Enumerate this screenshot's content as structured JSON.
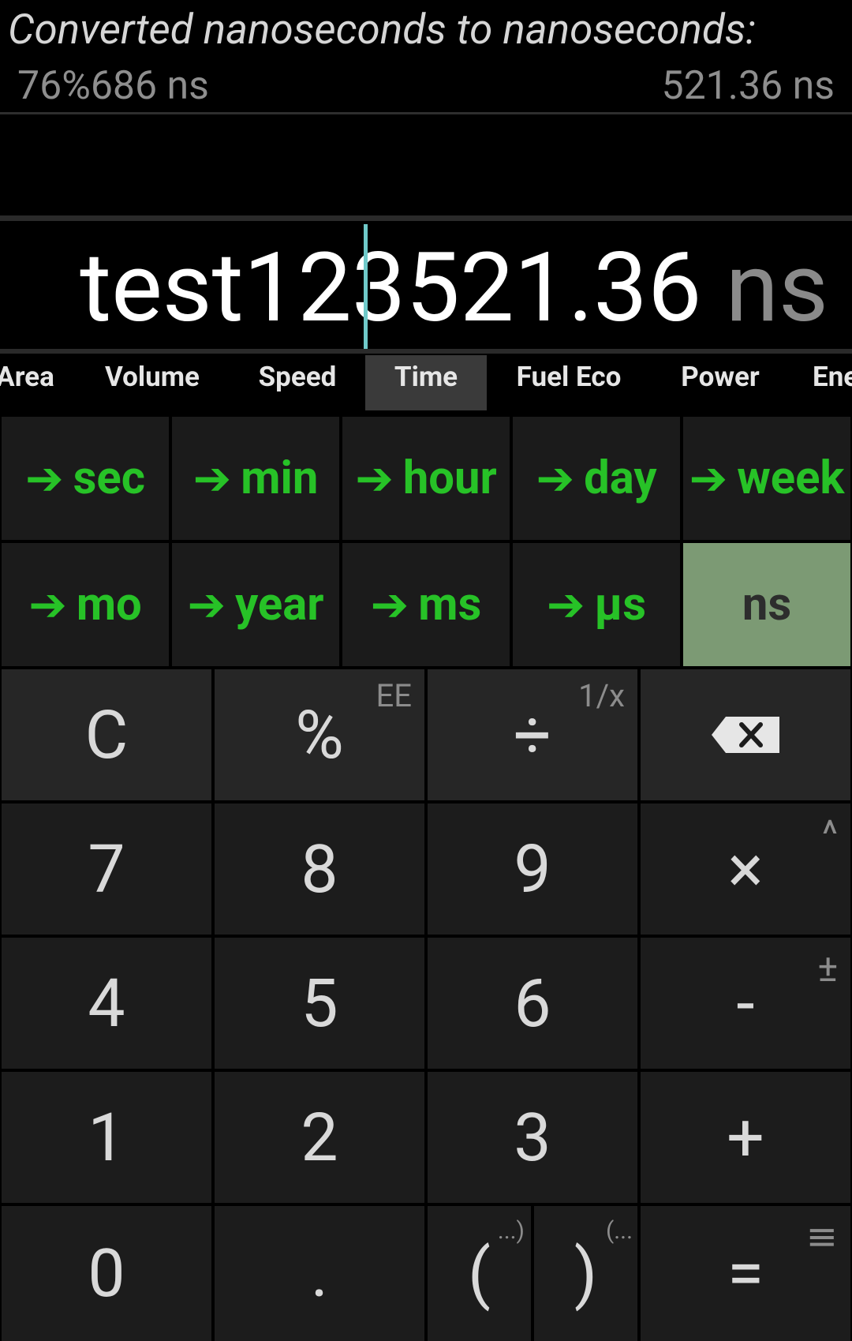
{
  "history": {
    "title": "Converted nanoseconds to nanoseconds:",
    "expression": "76%686 ns",
    "result": "521.36 ns"
  },
  "display": {
    "before_cursor": "test12",
    "after_cursor": "3521.36",
    "unit": " ns"
  },
  "tabs": [
    "Area",
    "Volume",
    "Speed",
    "Time",
    "Fuel Eco",
    "Power",
    "Ene"
  ],
  "active_tab": "Time",
  "units": {
    "row1": [
      "sec",
      "min",
      "hour",
      "day",
      "week"
    ],
    "row2": [
      "mo",
      "year",
      "ms",
      "µs"
    ],
    "selected": "ns",
    "arrow": "➔"
  },
  "keys": {
    "clear": "C",
    "percent": "%",
    "percent_sub": "EE",
    "divide": "÷",
    "divide_sub": "1/x",
    "seven": "7",
    "eight": "8",
    "nine": "9",
    "multiply": "×",
    "multiply_sub": "^",
    "four": "4",
    "five": "5",
    "six": "6",
    "minus": "-",
    "minus_sub": "±",
    "one": "1",
    "two": "2",
    "three": "3",
    "plus": "+",
    "zero": "0",
    "dot": ".",
    "open_paren": "(",
    "open_paren_sub": "...)",
    "close_paren": ")",
    "close_paren_sub": "(...",
    "equals": "=",
    "equals_sub": "≡"
  }
}
